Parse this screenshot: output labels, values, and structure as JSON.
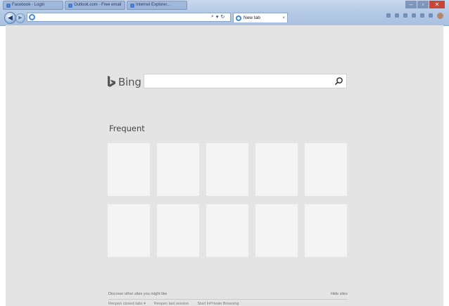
{
  "browser": {
    "taskbar_tabs": [
      {
        "label": "Facebook - Login"
      },
      {
        "label": "Outlook.com - Free email"
      },
      {
        "label": "Internet Explorer..."
      }
    ],
    "window_controls": {
      "minimize": "–",
      "maximize": "▫",
      "close": "✕"
    },
    "address": {
      "value": ""
    },
    "address_actions": {
      "search": "⌕",
      "dropdown": "▾",
      "refresh": "↻"
    },
    "active_tab": {
      "title": "New tab",
      "close": "×"
    }
  },
  "new_tab": {
    "bing": {
      "brand": "Bing",
      "search_placeholder": ""
    },
    "frequent_heading": "Frequent",
    "tiles": [
      {},
      {},
      {},
      {},
      {},
      {},
      {},
      {},
      {},
      {}
    ],
    "footer": {
      "discover": "Discover other sites you might like",
      "hide_sites": "Hide sites",
      "reopen_closed": "Reopen closed tabs ▾",
      "reopen_last": "Reopen last session",
      "inprivate": "Start InPrivate Browsing"
    }
  },
  "colors": {
    "page_background": "#e4e4e4",
    "tile": "#f4f4f4",
    "chrome": "#b6cbe6"
  }
}
